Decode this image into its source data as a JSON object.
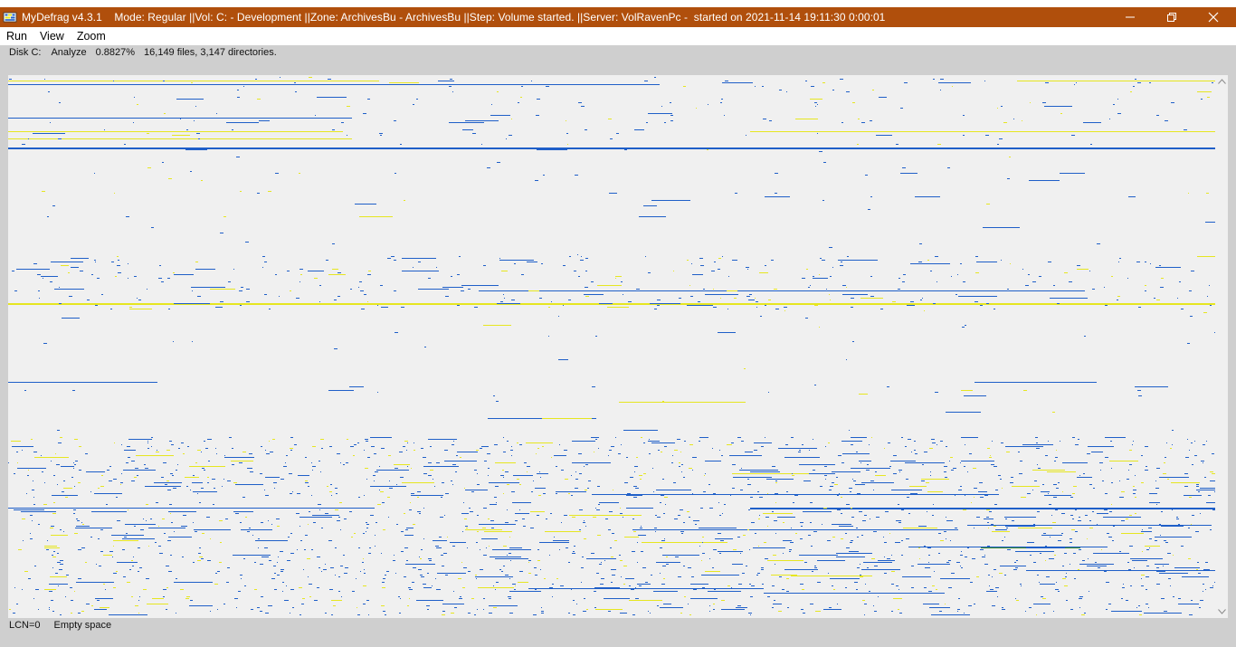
{
  "window": {
    "app_name": "MyDefrag v4.3.1",
    "title": "MyDefrag v4.3.1    Mode: Regular ||Vol: C: - Development ||Zone: ArchivesBu - ArchivesBu ||Step: Volume started. ||Server: VolRavenPc -  started on 2021-11-14 19:11:30 0:00:01",
    "controls": [
      "minimize",
      "restore",
      "close"
    ]
  },
  "menu": {
    "items": [
      "Run",
      "View",
      "Zoom"
    ]
  },
  "status_top": {
    "disk": "Disk C:",
    "action": "Analyze",
    "progress": "0.8827%",
    "counts": "16,149 files, 3,147 directories."
  },
  "status_bottom": {
    "lcn": "LCN=0",
    "description": "Empty space"
  },
  "colors": {
    "titlebar": "#b04f0c",
    "file_blue": "#1f5fc8",
    "file_yellow": "#e6e620",
    "file_green": "#3a8a2a",
    "empty": "#f0f0f0"
  }
}
